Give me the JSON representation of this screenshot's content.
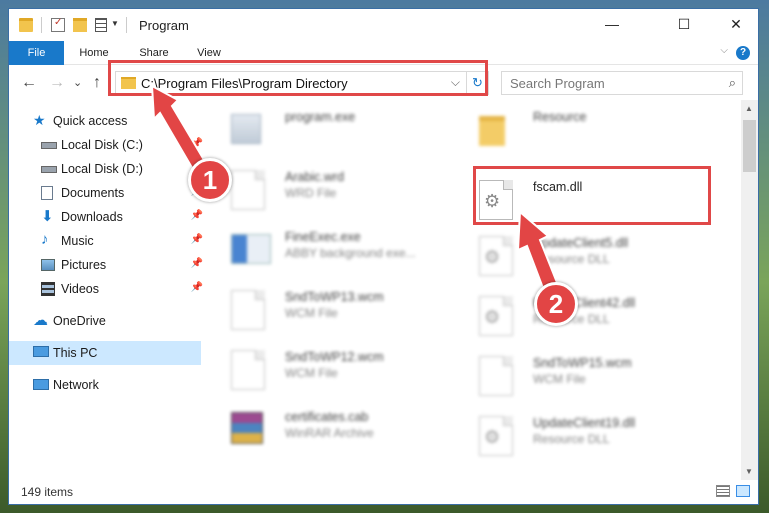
{
  "window": {
    "title": "Program",
    "controls": {
      "minimize": "—",
      "maximize": "☐",
      "close": "✕"
    }
  },
  "ribbon": {
    "tabs": [
      "File",
      "Home",
      "Share",
      "View"
    ],
    "help": "?"
  },
  "address": {
    "path": "C:\\Program Files\\Program Directory",
    "refresh": "↻",
    "dropdown": "⌵"
  },
  "search": {
    "placeholder": "Search Program",
    "icon": "search-icon"
  },
  "nav": {
    "back": "←",
    "forward": "→",
    "recent": "⌄",
    "up": "↑"
  },
  "sidebar": {
    "items": [
      {
        "label": "Quick access",
        "icon": "star-icon"
      },
      {
        "label": "Local Disk (C:)",
        "icon": "drive-icon"
      },
      {
        "label": "Local Disk (D:)",
        "icon": "drive-icon"
      },
      {
        "label": "Documents",
        "icon": "documents-icon"
      },
      {
        "label": "Downloads",
        "icon": "downloads-icon"
      },
      {
        "label": "Music",
        "icon": "music-icon"
      },
      {
        "label": "Pictures",
        "icon": "pictures-icon"
      },
      {
        "label": "Videos",
        "icon": "videos-icon"
      },
      {
        "label": "OneDrive",
        "icon": "cloud-icon"
      },
      {
        "label": "This PC",
        "icon": "computer-icon"
      },
      {
        "label": "Network",
        "icon": "network-icon"
      }
    ]
  },
  "files": {
    "left": [
      {
        "name": "program.exe",
        "type": ""
      },
      {
        "name": "Arabic.wrd",
        "type": "WRD File"
      },
      {
        "name": "FineExec.exe",
        "type": "ABBY background exe..."
      },
      {
        "name": "SndToWP13.wcm",
        "type": "WCM File"
      },
      {
        "name": "SndToWP12.wcm",
        "type": "WCM File"
      },
      {
        "name": "certificates.cab",
        "type": "WinRAR Archive"
      }
    ],
    "right": [
      {
        "name": "Resource",
        "type": ""
      },
      {
        "name": "fscam.dll",
        "type": ""
      },
      {
        "name": "UpdateClient5.dll",
        "type": "Resource DLL"
      },
      {
        "name": "UpdateClient42.dll",
        "type": "Resource DLL"
      },
      {
        "name": "SndToWP15.wcm",
        "type": "WCM File"
      },
      {
        "name": "UpdateClient19.dll",
        "type": "Resource DLL"
      }
    ]
  },
  "status": {
    "item_count": "149 items"
  },
  "annotations": {
    "step1": "1",
    "step2": "2",
    "highlight_color": "#e04848"
  },
  "colors": {
    "accent": "#1979ca",
    "selection": "#cce8ff"
  }
}
